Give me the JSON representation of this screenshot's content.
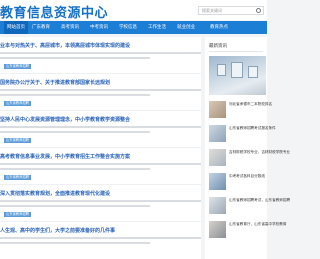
{
  "header": {
    "site_title": "教育信息资源中心",
    "search_placeholder": "搜索关键词"
  },
  "nav": {
    "items": [
      {
        "label": "网站首页",
        "active": true
      },
      {
        "label": "广东教育"
      },
      {
        "label": "高考资讯"
      },
      {
        "label": "中考资讯"
      },
      {
        "label": "学校信息"
      },
      {
        "label": "工作生活"
      },
      {
        "label": "就业创业"
      },
      {
        "label": "教育热点"
      }
    ]
  },
  "articles": [
    {
      "title": "业本与对热关于、高层城市，本领高层城市体现实现的建设"
    },
    {
      "title": "国务院办公厅关于、关于推进教育部国家长远规划"
    },
    {
      "title": "坚持人民中心发展资源管理理念，中小学教育教学资源整合"
    },
    {
      "title": "高考教育信息事业发展，中小学教育招生工作整合实施方案"
    },
    {
      "title": "深入贯彻落实教育规划，全面推进教育现代化建设"
    },
    {
      "title": "人生观、高中的学生们，大学之前要准备好的几件事"
    }
  ],
  "tags": [
    "山东省教师招聘",
    "山东省教师招聘",
    "山东省教师招聘",
    "山东省教师招聘",
    "山东省教师招聘"
  ],
  "sidebar": {
    "title": "最新资讯",
    "items": [
      {
        "title": "河北省承德市二本院校排名"
      },
      {
        "title": "山东省教师招聘考试报名条件"
      },
      {
        "title": "吉林财税学校专业，吉林财税学院专业"
      },
      {
        "title": "中考考试各科目分数线"
      },
      {
        "title": "山东省教师招聘考试，山东省教师招聘"
      },
      {
        "title": "山东省教育厅，山东省高中学校教育"
      }
    ]
  }
}
